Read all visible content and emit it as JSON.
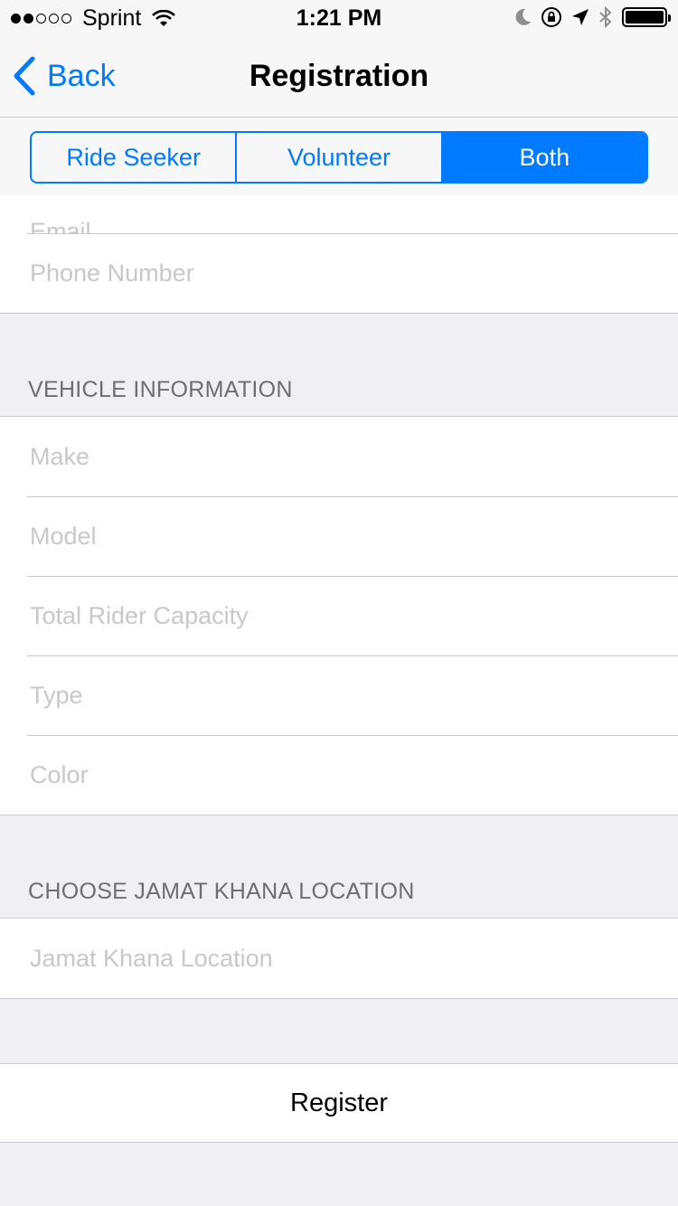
{
  "status_bar": {
    "carrier": "Sprint",
    "time": "1:21 PM"
  },
  "nav": {
    "back_label": "Back",
    "title": "Registration"
  },
  "segments": [
    {
      "label": "Ride Seeker",
      "selected": false
    },
    {
      "label": "Volunteer",
      "selected": false
    },
    {
      "label": "Both",
      "selected": true
    }
  ],
  "contact": {
    "email_placeholder": "Email",
    "phone_placeholder": "Phone Number"
  },
  "vehicle": {
    "header": "VEHICLE INFORMATION",
    "make_placeholder": "Make",
    "model_placeholder": "Model",
    "capacity_placeholder": "Total Rider Capacity",
    "type_placeholder": "Type",
    "color_placeholder": "Color"
  },
  "location": {
    "header": "CHOOSE JAMAT KHANA LOCATION",
    "location_placeholder": "Jamat Khana Location"
  },
  "register_label": "Register",
  "colors": {
    "accent": "#007aff",
    "placeholder": "#c7c7cd",
    "section_header": "#6d6d72",
    "background": "#efeff4"
  }
}
